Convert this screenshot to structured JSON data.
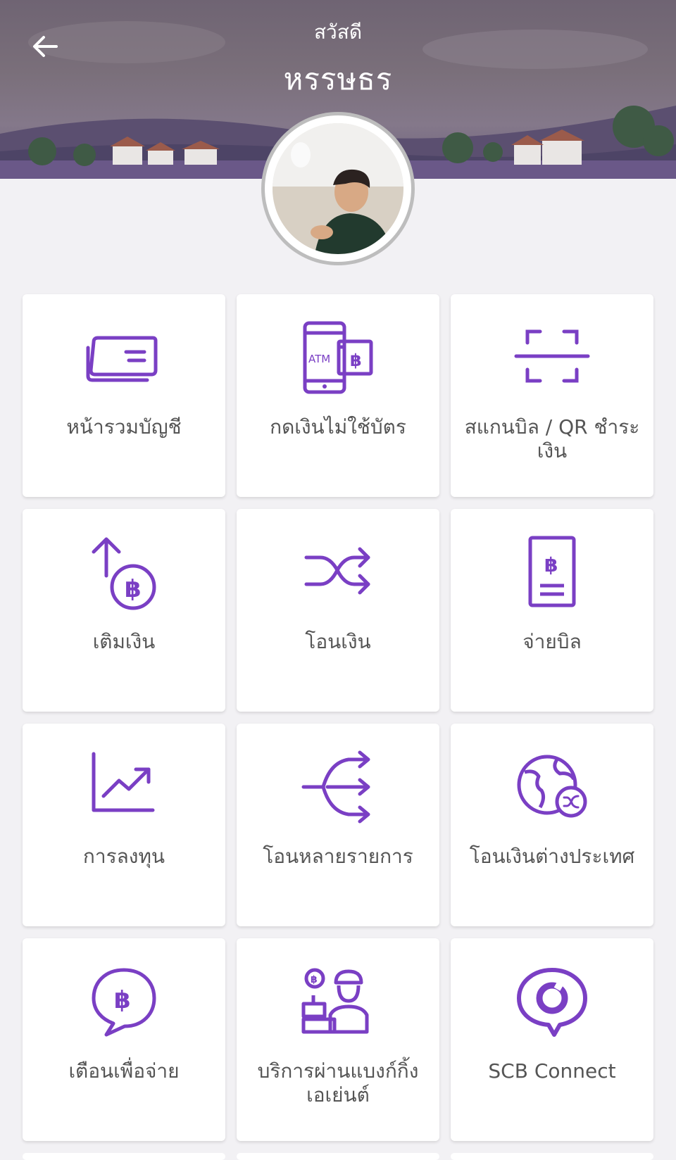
{
  "header": {
    "greeting": "สวัสดี",
    "username": "หรรษธร",
    "back_icon": "back-arrow-icon"
  },
  "profile": {
    "avatar_icon": "profile-photo"
  },
  "colors": {
    "accent": "#7a3fc4",
    "tile_bg": "#ffffff",
    "page_bg": "#f2f1f4",
    "label": "#555555"
  },
  "menu": [
    {
      "id": "accounts",
      "label": "หน้ารวมบัญชี",
      "icon": "card-icon"
    },
    {
      "id": "cardless",
      "label": "กดเงินไม่ใช้บัตร",
      "icon": "atm-phone-icon"
    },
    {
      "id": "scan",
      "label": "สแกนบิล / QR ชำระเงิน",
      "icon": "scan-icon"
    },
    {
      "id": "topup",
      "label": "เติมเงิน",
      "icon": "topup-icon"
    },
    {
      "id": "transfer",
      "label": "โอนเงิน",
      "icon": "transfer-icon"
    },
    {
      "id": "paybill",
      "label": "จ่ายบิล",
      "icon": "bill-icon"
    },
    {
      "id": "invest",
      "label": "การลงทุน",
      "icon": "chart-icon"
    },
    {
      "id": "multi",
      "label": "โอนหลายรายการ",
      "icon": "multi-transfer-icon"
    },
    {
      "id": "intl",
      "label": "โอนเงินต่างประเทศ",
      "icon": "globe-transfer-icon"
    },
    {
      "id": "remind",
      "label": "เตือนเพื่อจ่าย",
      "icon": "chat-baht-icon"
    },
    {
      "id": "agent",
      "label": "บริการผ่านแบงก์กิ้งเอเย่นต์",
      "icon": "agent-icon"
    },
    {
      "id": "connect",
      "label": "SCB Connect",
      "icon": "scb-connect-icon"
    }
  ]
}
